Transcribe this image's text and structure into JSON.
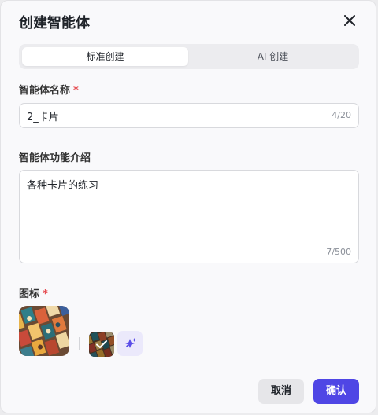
{
  "dialog": {
    "title": "创建智能体",
    "tabs": [
      {
        "label": "标准创建",
        "active": true
      },
      {
        "label": "AI 创建",
        "active": false
      }
    ],
    "name_field": {
      "label": "智能体名称",
      "required_mark": "*",
      "value": "2_卡片",
      "count": "4/20"
    },
    "desc_field": {
      "label": "智能体功能介绍",
      "value": "各种卡片的练习",
      "count": "7/500"
    },
    "icon_field": {
      "label": "图标",
      "required_mark": "*",
      "ai_icon": "sparkle-icon"
    },
    "buttons": {
      "cancel": "取消",
      "confirm": "确认"
    },
    "colors": {
      "primary": "#4f46e5",
      "required": "#e5484d",
      "ai_bg": "#ebe9fb"
    }
  }
}
